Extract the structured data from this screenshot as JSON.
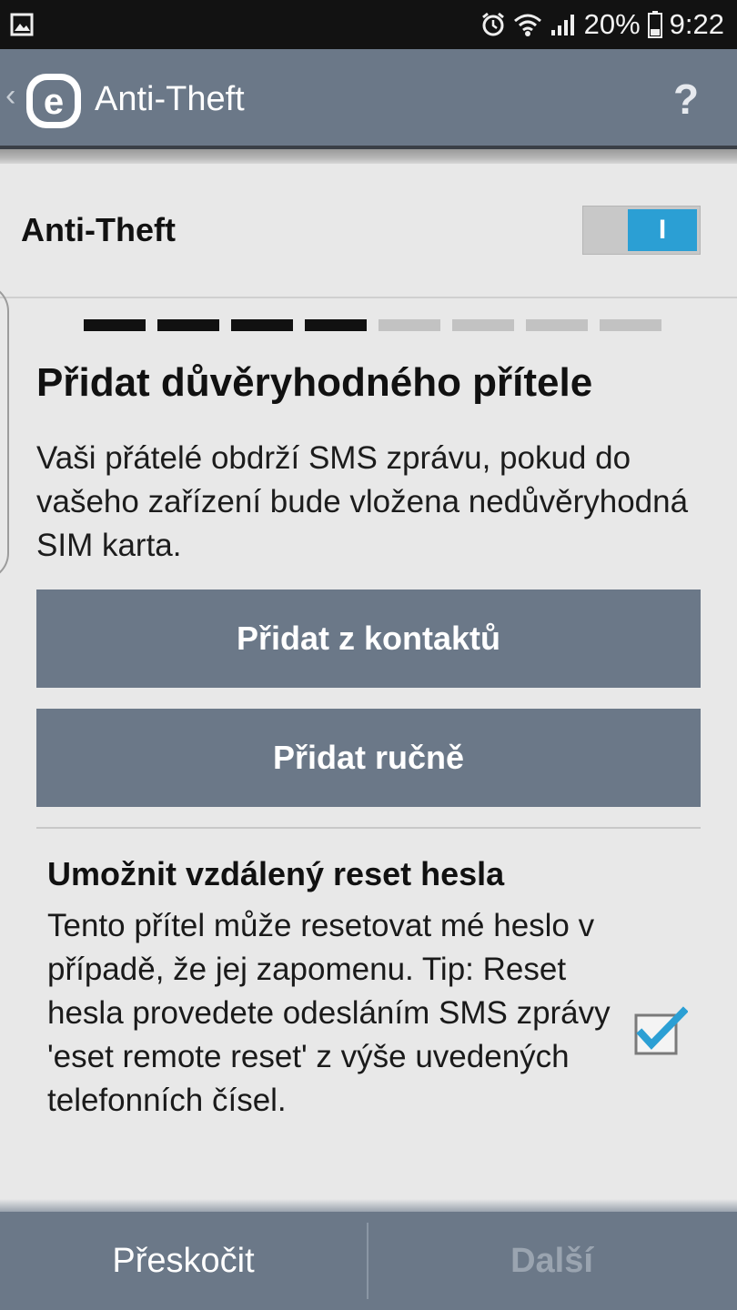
{
  "status_bar": {
    "battery": "20%",
    "time": "9:22",
    "icons": [
      "gallery-icon",
      "alarm-icon",
      "wifi-icon",
      "signal-icon",
      "battery-icon"
    ]
  },
  "app_bar": {
    "title": "Anti-Theft",
    "help_label": "?",
    "logo_letter": "e"
  },
  "feature": {
    "label": "Anti-Theft",
    "toggle_state_label": "I",
    "enabled": true
  },
  "wizard": {
    "total_steps": 8,
    "completed_steps": 4,
    "heading": "Přidat důvěryhodného přítele",
    "description": "Vaši přátelé obdrží SMS zprávu, pokud do vašeho zařízení bude vložena nedůvěryhodná SIM karta.",
    "add_from_contacts": "Přidat z kontaktů",
    "add_manually": "Přidat ručně"
  },
  "option": {
    "title": "Umožnit vzdálený reset hesla",
    "description": "Tento přítel může resetovat mé heslo v případě, že jej zapomenu. Tip: Reset hesla provedete odesláním SMS zprávy 'eset remote reset' z výše uvedených telefonních čísel.",
    "checked": true
  },
  "bottom_bar": {
    "skip": "Přeskočit",
    "next": "Další"
  },
  "colors": {
    "bar": "#6b7888",
    "accent": "#2b9fd4",
    "disabled_text": "#9aa4b0"
  }
}
